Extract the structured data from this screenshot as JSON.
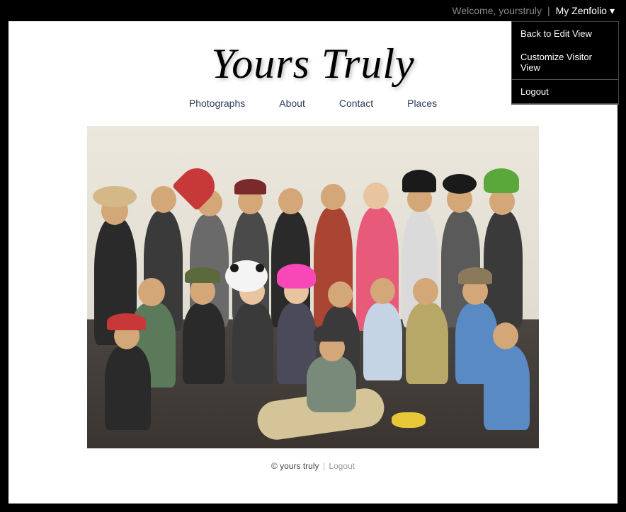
{
  "topbar": {
    "welcome": "Welcome, yourstruly",
    "separator": "|",
    "menu_label": "My Zenfolio",
    "dropdown": {
      "back_to_edit": "Back to Edit View",
      "customize": "Customize Visitor View",
      "logout": "Logout"
    }
  },
  "site": {
    "title": "Yours Truly"
  },
  "nav": {
    "photographs": "Photographs",
    "about": "About",
    "contact": "Contact",
    "places": "Places"
  },
  "footer": {
    "copyright": "© yours truly",
    "separator": "|",
    "logout": "Logout"
  }
}
